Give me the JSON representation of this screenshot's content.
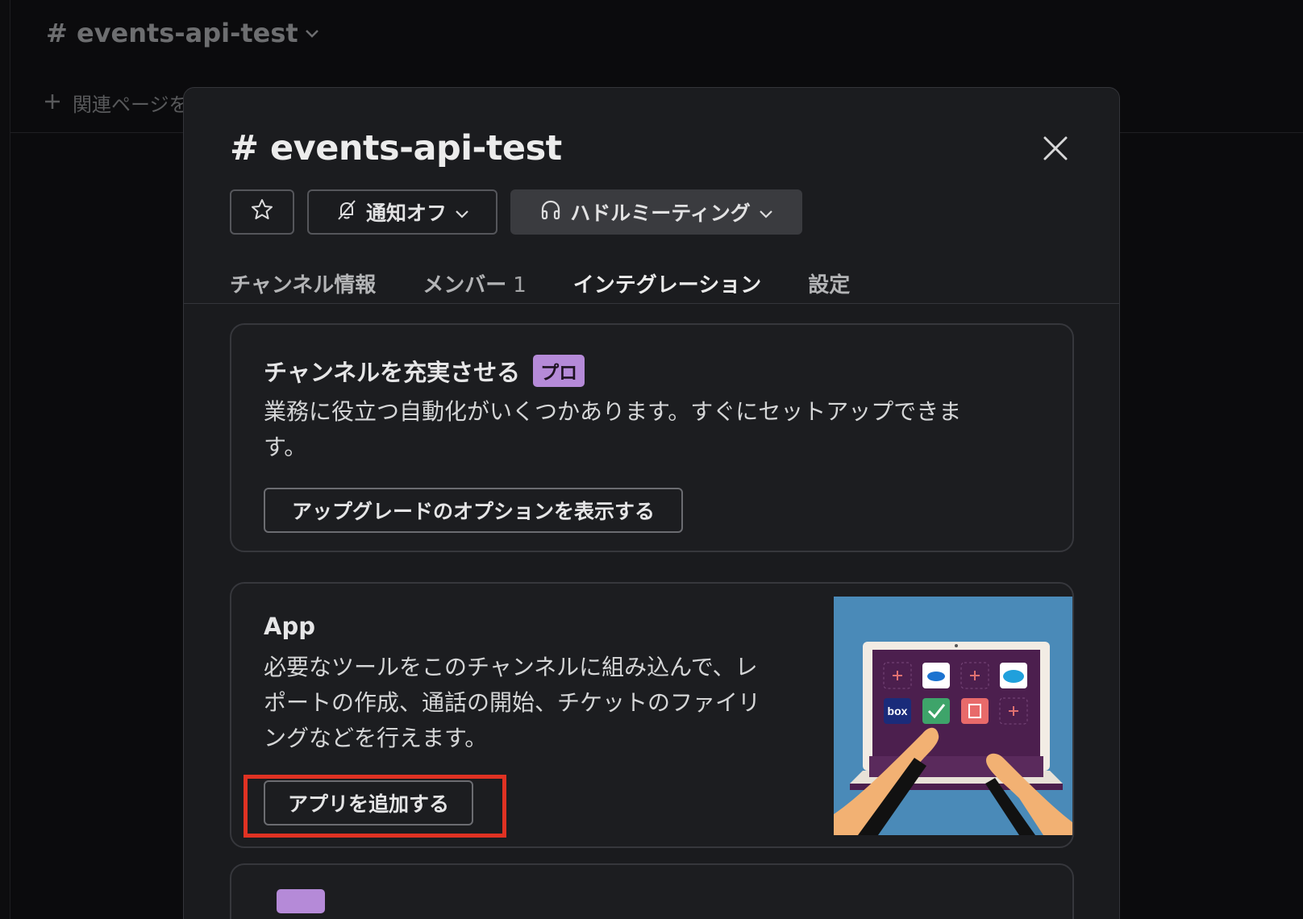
{
  "background": {
    "channel_name": "# events-api-test",
    "related_pages_label": "関連ページを"
  },
  "modal": {
    "title": "# events-api-test",
    "toolbar": {
      "notify_label": "通知オフ",
      "huddle_label": "ハドルミーティング"
    },
    "tabs": [
      {
        "label": "チャンネル情報"
      },
      {
        "label": "メンバー",
        "count": "1"
      },
      {
        "label": "インテグレーション",
        "active": true
      },
      {
        "label": "設定"
      }
    ],
    "enrich_card": {
      "title": "チャンネルを充実させる",
      "badge": "プロ",
      "description_line1": "業務に役立つ自動化がいくつかあります。すぐにセットアップできま",
      "description_line2": "す。",
      "button": "アップグレードのオプションを表示する"
    },
    "apps_card": {
      "title": "App",
      "description_line1": "必要なツールをこのチャンネルに組み込んで、レ",
      "description_line2": "ポートの作成、通話の開始、チケットのファイリ",
      "description_line3": "ングなどを行えます。",
      "button": "アプリを追加する",
      "illustration_tiles": [
        "+",
        "cloud",
        "+",
        "salesforce",
        "box",
        "check",
        "E",
        "+"
      ],
      "illustration_box_label": "box"
    },
    "third_card": {
      "badge": ""
    }
  },
  "colors": {
    "accent_tab_underline": "#1d5fd1",
    "pro_badge": "#b58ad8",
    "highlight": "#e03223",
    "illustration_bg": "#4a8ab8"
  },
  "icons": [
    "star-icon",
    "bell-off-icon",
    "headphones-icon",
    "chevron-down-icon",
    "close-icon",
    "plus-icon"
  ]
}
